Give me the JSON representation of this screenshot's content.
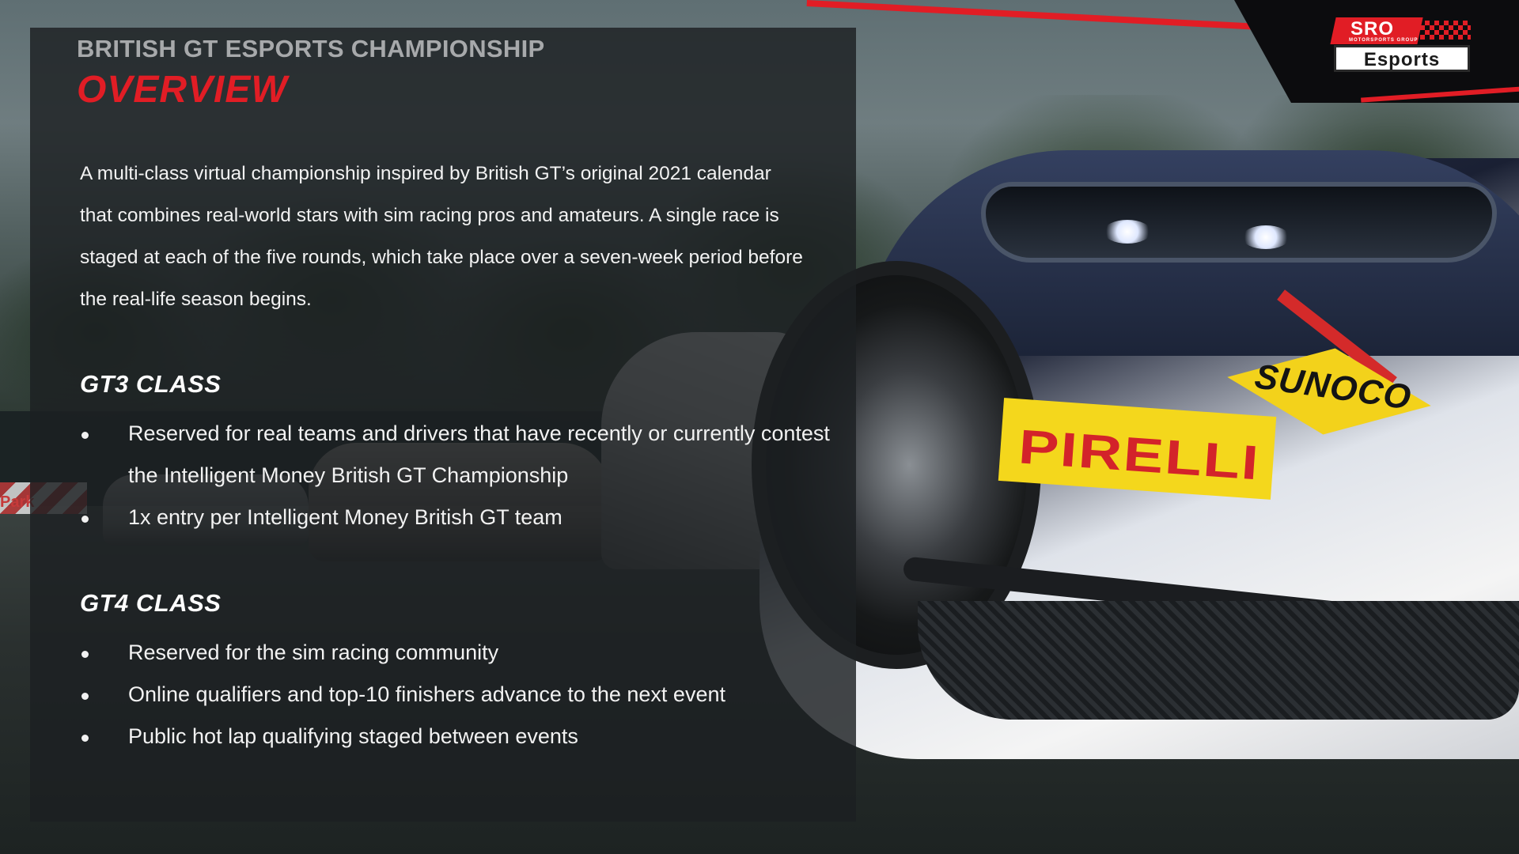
{
  "header": {
    "eyebrow": "BRITISH GT ESPORTS CHAMPIONSHIP",
    "title": "OVERVIEW"
  },
  "intro": "A multi-class virtual championship inspired by British GT’s original 2021 calendar that combines real-world stars with sim racing pros and amateurs. A single race is staged at each of the five rounds, which take place over a seven-week period before the real-life season begins.",
  "gt3": {
    "heading": "GT3 CLASS",
    "bullets": [
      "Reserved for real teams and drivers that have recently or currently contest the Intelligent Money British GT Championship",
      "1x entry per Intelligent Money British GT team"
    ]
  },
  "gt4": {
    "heading": "GT4 CLASS",
    "bullets": [
      "Reserved for the sim racing community",
      "Online qualifiers and top-10 finishers advance to the next event",
      "Public hot lap qualifying staged between events"
    ]
  },
  "logo": {
    "sro": "SRO",
    "sro_sub": "MOTORSPORTS GROUP",
    "esports": "Esports"
  },
  "scene": {
    "sunoco": "SUNOCO",
    "pirelli": "PIRELLI",
    "kerb": "Park"
  },
  "colors": {
    "accent": "#e11d25",
    "panel": "#1c2022",
    "text": "#f2f2f2",
    "eyebrow": "#a7a9ab"
  }
}
